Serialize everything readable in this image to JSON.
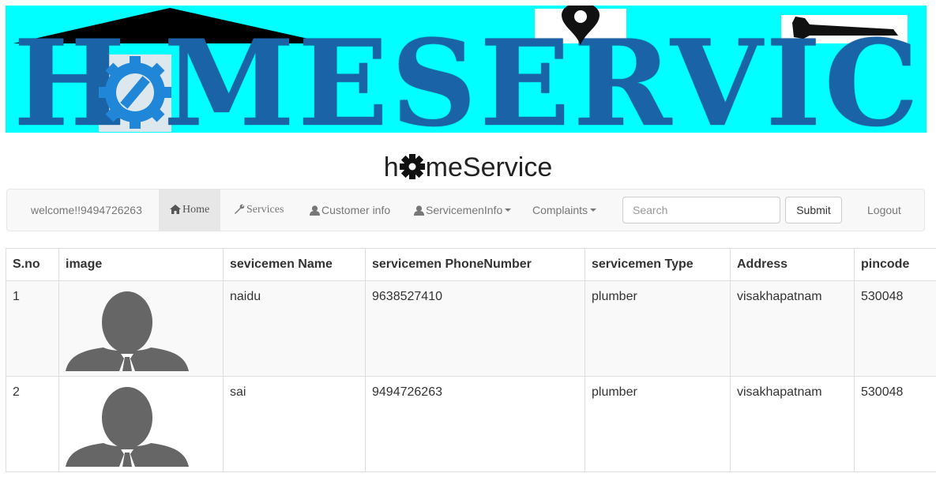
{
  "banner": {
    "h": "H",
    "me": "ME",
    "services": "SERVICES"
  },
  "app_title": {
    "before": "h",
    "after": "meService"
  },
  "navbar": {
    "welcome": "welcome!!9494726263",
    "home": "Home",
    "services": "Services",
    "customer_info": "Customer info",
    "servicemen_info": "ServicemenInfo",
    "complaints": "Complaints",
    "search_placeholder": "Search",
    "submit": "Submit",
    "logout": "Logout"
  },
  "table": {
    "headers": [
      "S.no",
      "image",
      "sevicemen Name",
      "servicemen PhoneNumber",
      "servicemen Type",
      "Address",
      "pincode"
    ],
    "rows": [
      {
        "sno": "1",
        "name": "naidu",
        "phone": "9638527410",
        "type": "plumber",
        "address": "visakhapatnam",
        "pincode": "530048"
      },
      {
        "sno": "2",
        "name": "sai",
        "phone": "9494726263",
        "type": "plumber",
        "address": "visakhapatnam",
        "pincode": "530048"
      }
    ]
  },
  "colors": {
    "banner_bg": "#00ffff",
    "banner_text": "#1a63a7",
    "navbar_bg": "#f8f8f8",
    "avatar": "#666666"
  }
}
